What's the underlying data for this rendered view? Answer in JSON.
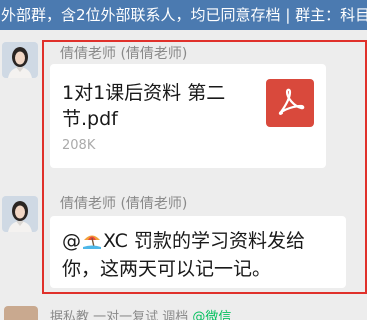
{
  "banner": {
    "text": "外部群，含2位外部联系人，均已同意存档 | 群主：科目"
  },
  "messages": [
    {
      "sender": "倩倩老师 (倩倩老师)",
      "type": "file",
      "file_name": "1对1课后资料  第二节.pdf",
      "file_size": "208K",
      "file_icon": "pdf-icon"
    },
    {
      "sender": "倩倩老师 (倩倩老师)",
      "type": "text",
      "text_prefix": "@",
      "mention_emoji": "beach-umbrella-icon",
      "text_body": "XC 罚款的学习资料发给你，这两天可以记一记。"
    }
  ],
  "next_message": {
    "preview": "据私教  一对一复试 调档",
    "tag": "@微信"
  },
  "colors": {
    "banner_bg": "#4b7ab0",
    "highlight_border": "#e0312b",
    "pdf_red": "#d9493c",
    "wechat_green": "#07c160"
  }
}
